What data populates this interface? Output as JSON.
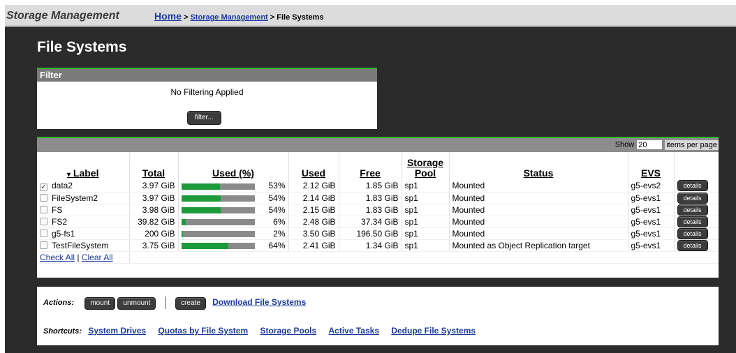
{
  "topbar": {
    "app_title": "Storage Management",
    "breadcrumb": {
      "home": "Home",
      "sep1": ">",
      "storage": "Storage Management",
      "sep2": ">",
      "current": "File Systems"
    }
  },
  "page": {
    "title": "File Systems"
  },
  "filter": {
    "header": "Filter",
    "status": "No Filtering Applied",
    "button": "filter..."
  },
  "table": {
    "show_label": "Show",
    "items_per_page_value": "20",
    "items_per_page_label": "items per page",
    "columns": {
      "label": "Label",
      "sort_indicator": "▾",
      "total": "Total",
      "used_pct": "Used (%)",
      "used": "Used",
      "free": "Free",
      "storage_pool": "Storage Pool",
      "status": "Status",
      "evs": "EVS"
    },
    "rows": [
      {
        "label": "data2",
        "checked": true,
        "total": "3.97 GiB",
        "used_pct": "53%",
        "used_frac": 0.53,
        "used": "2.12 GiB",
        "free": "1.85 GiB",
        "pool": "sp1",
        "status": "Mounted",
        "evs": "g5-evs2",
        "details": "details"
      },
      {
        "label": "FileSystem2",
        "checked": false,
        "total": "3.97 GiB",
        "used_pct": "54%",
        "used_frac": 0.54,
        "used": "2.14 GiB",
        "free": "1.83 GiB",
        "pool": "sp1",
        "status": "Mounted",
        "evs": "g5-evs1",
        "details": "details"
      },
      {
        "label": "FS",
        "checked": false,
        "total": "3.98 GiB",
        "used_pct": "54%",
        "used_frac": 0.54,
        "used": "2.15 GiB",
        "free": "1.83 GiB",
        "pool": "sp1",
        "status": "Mounted",
        "evs": "g5-evs1",
        "details": "details"
      },
      {
        "label": "FS2",
        "checked": false,
        "total": "39.82 GiB",
        "used_pct": "6%",
        "used_frac": 0.06,
        "used": "2.48 GiB",
        "free": "37.34 GiB",
        "pool": "sp1",
        "status": "Mounted",
        "evs": "g5-evs1",
        "details": "details"
      },
      {
        "label": "g5-fs1",
        "checked": false,
        "total": "200 GiB",
        "used_pct": "2%",
        "used_frac": 0.02,
        "used": "3.50 GiB",
        "free": "196.50 GiB",
        "pool": "sp1",
        "status": "Mounted",
        "evs": "g5-evs1",
        "details": "details"
      },
      {
        "label": "TestFileSystem",
        "checked": false,
        "total": "3.75 GiB",
        "used_pct": "64%",
        "used_frac": 0.64,
        "used": "2.41 GiB",
        "free": "1.34 GiB",
        "pool": "sp1",
        "status": "Mounted as Object Replication target",
        "evs": "g5-evs1",
        "details": "details"
      }
    ],
    "check_all": "Check All",
    "check_sep": "|",
    "clear_all": "Clear All"
  },
  "actions": {
    "label": "Actions:",
    "mount": "mount",
    "unmount": "unmount",
    "create": "create",
    "download": "Download File Systems"
  },
  "shortcuts": {
    "label": "Shortcuts:",
    "items": [
      "System Drives",
      "Quotas by File System",
      "Storage Pools",
      "Active Tasks",
      "Dedupe File Systems"
    ]
  },
  "colors": {
    "accent_green": "#2fb52f",
    "bar_fill": "#1d9a3a",
    "link_blue": "#1a3a9a"
  }
}
